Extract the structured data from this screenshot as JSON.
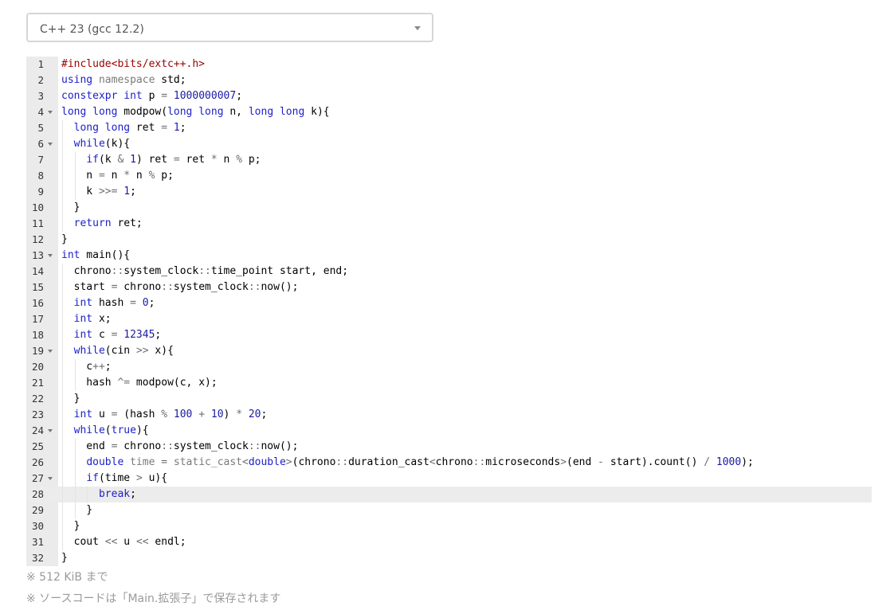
{
  "language_select": {
    "value": "C++ 23 (gcc 12.2)"
  },
  "editor": {
    "active_line": 28,
    "lines": [
      {
        "no": "1",
        "fold": false,
        "t": [
          [
            "inc",
            "#include<bits/extc++.h>"
          ]
        ]
      },
      {
        "no": "2",
        "fold": false,
        "t": [
          [
            "k",
            "using"
          ],
          [
            "",
            ""
          ],
          [
            "g",
            " namespace"
          ],
          [
            "",
            " std;"
          ]
        ]
      },
      {
        "no": "3",
        "fold": false,
        "t": [
          [
            "k",
            "constexpr"
          ],
          [
            "",
            " "
          ],
          [
            "k",
            "int"
          ],
          [
            "",
            " p "
          ],
          [
            "o",
            "="
          ],
          [
            "",
            " "
          ],
          [
            "n",
            "1000000007"
          ],
          [
            "",
            ";"
          ]
        ]
      },
      {
        "no": "4",
        "fold": true,
        "t": [
          [
            "k",
            "long long"
          ],
          [
            "",
            " modpow("
          ],
          [
            "k",
            "long long"
          ],
          [
            "",
            " n, "
          ],
          [
            "k",
            "long long"
          ],
          [
            "",
            " k){"
          ]
        ]
      },
      {
        "no": "5",
        "fold": false,
        "t": [
          [
            "",
            "  "
          ],
          [
            "k",
            "long long"
          ],
          [
            "",
            " ret "
          ],
          [
            "o",
            "="
          ],
          [
            "",
            " "
          ],
          [
            "n",
            "1"
          ],
          [
            "",
            ";"
          ]
        ]
      },
      {
        "no": "6",
        "fold": true,
        "t": [
          [
            "",
            "  "
          ],
          [
            "k",
            "while"
          ],
          [
            "",
            "(k){"
          ]
        ]
      },
      {
        "no": "7",
        "fold": false,
        "t": [
          [
            "",
            "    "
          ],
          [
            "k",
            "if"
          ],
          [
            "",
            "(k "
          ],
          [
            "o",
            "&"
          ],
          [
            "",
            " "
          ],
          [
            "n",
            "1"
          ],
          [
            "",
            ") ret "
          ],
          [
            "o",
            "="
          ],
          [
            "",
            " ret "
          ],
          [
            "o",
            "*"
          ],
          [
            "",
            " n "
          ],
          [
            "o",
            "%"
          ],
          [
            "",
            " p;"
          ]
        ]
      },
      {
        "no": "8",
        "fold": false,
        "t": [
          [
            "",
            "    n "
          ],
          [
            "o",
            "="
          ],
          [
            "",
            " n "
          ],
          [
            "o",
            "*"
          ],
          [
            "",
            " n "
          ],
          [
            "o",
            "%"
          ],
          [
            "",
            " p;"
          ]
        ]
      },
      {
        "no": "9",
        "fold": false,
        "t": [
          [
            "",
            "    k "
          ],
          [
            "o",
            ">>="
          ],
          [
            "",
            " "
          ],
          [
            "n",
            "1"
          ],
          [
            "",
            ";"
          ]
        ]
      },
      {
        "no": "10",
        "fold": false,
        "t": [
          [
            "",
            "  }"
          ]
        ]
      },
      {
        "no": "11",
        "fold": false,
        "t": [
          [
            "",
            "  "
          ],
          [
            "k",
            "return"
          ],
          [
            "",
            " ret;"
          ]
        ]
      },
      {
        "no": "12",
        "fold": false,
        "t": [
          [
            "",
            "}"
          ]
        ]
      },
      {
        "no": "13",
        "fold": true,
        "t": [
          [
            "k",
            "int"
          ],
          [
            "",
            " main(){"
          ]
        ]
      },
      {
        "no": "14",
        "fold": false,
        "t": [
          [
            "",
            "  chrono"
          ],
          [
            "o",
            "::"
          ],
          [
            "",
            "system_clock"
          ],
          [
            "o",
            "::"
          ],
          [
            "",
            "time_point start, end;"
          ]
        ]
      },
      {
        "no": "15",
        "fold": false,
        "t": [
          [
            "",
            "  start "
          ],
          [
            "o",
            "="
          ],
          [
            "",
            " chrono"
          ],
          [
            "o",
            "::"
          ],
          [
            "",
            "system_clock"
          ],
          [
            "o",
            "::"
          ],
          [
            "",
            "now();"
          ]
        ]
      },
      {
        "no": "16",
        "fold": false,
        "t": [
          [
            "",
            "  "
          ],
          [
            "k",
            "int"
          ],
          [
            "",
            " hash "
          ],
          [
            "o",
            "="
          ],
          [
            "",
            " "
          ],
          [
            "n",
            "0"
          ],
          [
            "",
            ";"
          ]
        ]
      },
      {
        "no": "17",
        "fold": false,
        "t": [
          [
            "",
            "  "
          ],
          [
            "k",
            "int"
          ],
          [
            "",
            " x;"
          ]
        ]
      },
      {
        "no": "18",
        "fold": false,
        "t": [
          [
            "",
            "  "
          ],
          [
            "k",
            "int"
          ],
          [
            "",
            " c "
          ],
          [
            "o",
            "="
          ],
          [
            "",
            " "
          ],
          [
            "n",
            "12345"
          ],
          [
            "",
            ";"
          ]
        ]
      },
      {
        "no": "19",
        "fold": true,
        "t": [
          [
            "",
            "  "
          ],
          [
            "k",
            "while"
          ],
          [
            "",
            "(cin "
          ],
          [
            "o",
            ">>"
          ],
          [
            "",
            " x){"
          ]
        ]
      },
      {
        "no": "20",
        "fold": false,
        "t": [
          [
            "",
            "    c"
          ],
          [
            "o",
            "++"
          ],
          [
            "",
            ";"
          ]
        ]
      },
      {
        "no": "21",
        "fold": false,
        "t": [
          [
            "",
            "    hash "
          ],
          [
            "o",
            "^="
          ],
          [
            "",
            " modpow(c, x);"
          ]
        ]
      },
      {
        "no": "22",
        "fold": false,
        "t": [
          [
            "",
            "  }"
          ]
        ]
      },
      {
        "no": "23",
        "fold": false,
        "t": [
          [
            "",
            "  "
          ],
          [
            "k",
            "int"
          ],
          [
            "",
            " u "
          ],
          [
            "o",
            "="
          ],
          [
            "",
            " (hash "
          ],
          [
            "o",
            "%"
          ],
          [
            "",
            " "
          ],
          [
            "n",
            "100"
          ],
          [
            "",
            " "
          ],
          [
            "o",
            "+"
          ],
          [
            "",
            " "
          ],
          [
            "n",
            "10"
          ],
          [
            "",
            ") "
          ],
          [
            "o",
            "*"
          ],
          [
            "",
            " "
          ],
          [
            "n",
            "20"
          ],
          [
            "",
            ";"
          ]
        ]
      },
      {
        "no": "24",
        "fold": true,
        "t": [
          [
            "",
            "  "
          ],
          [
            "k",
            "while"
          ],
          [
            "",
            "("
          ],
          [
            "k",
            "true"
          ],
          [
            "",
            "){"
          ]
        ]
      },
      {
        "no": "25",
        "fold": false,
        "t": [
          [
            "",
            "    end "
          ],
          [
            "o",
            "="
          ],
          [
            "",
            " chrono"
          ],
          [
            "o",
            "::"
          ],
          [
            "",
            "system_clock"
          ],
          [
            "o",
            "::"
          ],
          [
            "",
            "now();"
          ]
        ]
      },
      {
        "no": "26",
        "fold": false,
        "t": [
          [
            "",
            "    "
          ],
          [
            "k",
            "double"
          ],
          [
            "",
            " "
          ],
          [
            "g",
            "time"
          ],
          [
            "",
            " "
          ],
          [
            "o",
            "="
          ],
          [
            "",
            " "
          ],
          [
            "g",
            "static_cast"
          ],
          [
            "o",
            "<"
          ],
          [
            "k",
            "double"
          ],
          [
            "o",
            ">"
          ],
          [
            "",
            "(chrono"
          ],
          [
            "o",
            "::"
          ],
          [
            "",
            "duration_cast"
          ],
          [
            "o",
            "<"
          ],
          [
            "",
            "chrono"
          ],
          [
            "o",
            "::"
          ],
          [
            "",
            "microseconds"
          ],
          [
            "o",
            ">"
          ],
          [
            "",
            "(end "
          ],
          [
            "o",
            "-"
          ],
          [
            "",
            " start).count() "
          ],
          [
            "o",
            "/"
          ],
          [
            "",
            " "
          ],
          [
            "n",
            "1000"
          ],
          [
            "",
            ");"
          ]
        ]
      },
      {
        "no": "27",
        "fold": true,
        "t": [
          [
            "",
            "    "
          ],
          [
            "k",
            "if"
          ],
          [
            "",
            "(time "
          ],
          [
            "o",
            ">"
          ],
          [
            "",
            " u){"
          ]
        ]
      },
      {
        "no": "28",
        "fold": false,
        "t": [
          [
            "",
            "      "
          ],
          [
            "k",
            "break"
          ],
          [
            "",
            ";"
          ]
        ]
      },
      {
        "no": "29",
        "fold": false,
        "t": [
          [
            "",
            "    }"
          ]
        ]
      },
      {
        "no": "30",
        "fold": false,
        "t": [
          [
            "",
            "  }"
          ]
        ]
      },
      {
        "no": "31",
        "fold": false,
        "t": [
          [
            "",
            "  cout "
          ],
          [
            "o",
            "<<"
          ],
          [
            "",
            " u "
          ],
          [
            "o",
            "<<"
          ],
          [
            "",
            " endl;"
          ]
        ]
      },
      {
        "no": "32",
        "fold": false,
        "t": [
          [
            "",
            "}"
          ]
        ]
      }
    ]
  },
  "notes": {
    "limit": "※ 512 KiB まで",
    "saved": "※ ソースコードは「Main.拡張子」で保存されます"
  }
}
